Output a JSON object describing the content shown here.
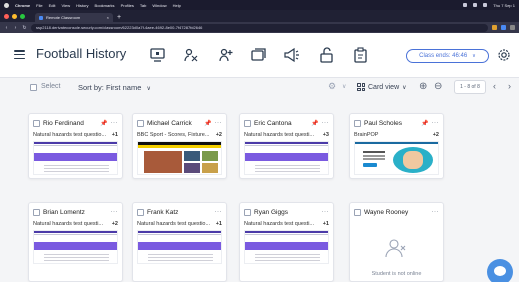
{
  "menubar": {
    "app": "Chrome",
    "items": [
      "File",
      "Edit",
      "View",
      "History",
      "Bookmarks",
      "Profiles",
      "Tab",
      "Window",
      "Help"
    ],
    "clock": "Thu 7 Sep 1"
  },
  "browser": {
    "tab_title": "Remote Classroom",
    "new_tab_icon": "+",
    "url": "ssp2118.derivateconsole.securly.com/classroom/62223d0a7f-4aee-4692-8e00-7f47287fd2646"
  },
  "header": {
    "title": "Football History",
    "class_ends": "Class ends: 46:46"
  },
  "toolbar": {
    "select_label": "Select",
    "sort_label": "Sort by:",
    "sort_value": "First name",
    "view_label": "Card view",
    "pagination": "1 - 8 of 8"
  },
  "cards": [
    {
      "name": "Rio Ferdinand",
      "pinned": true,
      "subtitle": "Natural hazards test questio...",
      "count": "+1",
      "thumb": "nh"
    },
    {
      "name": "Michael Carrick",
      "pinned": true,
      "subtitle": "BBC Sport - Scores, Fixture...",
      "count": "+2",
      "thumb": "bbc"
    },
    {
      "name": "Eric Cantona",
      "pinned": true,
      "subtitle": "Natural hazards test questi...",
      "count": "+3",
      "thumb": "nh"
    },
    {
      "name": "Paul Scholes",
      "pinned": true,
      "subtitle": "BrainPOP",
      "count": "+2",
      "thumb": "bp"
    },
    {
      "name": "Brian Lomentz",
      "pinned": false,
      "subtitle": "Natural hazards test questi...",
      "count": "+2",
      "thumb": "nh"
    },
    {
      "name": "Frank Katz",
      "pinned": false,
      "subtitle": "Natural hazards test questio...",
      "count": "+1",
      "thumb": "nh"
    },
    {
      "name": "Ryan Giggs",
      "pinned": false,
      "subtitle": "Natural hazards test questi...",
      "count": "+1",
      "thumb": "nh"
    },
    {
      "name": "Wayne Rooney",
      "pinned": false,
      "offline_text": "Student is not online"
    }
  ],
  "colors": {
    "accent": "#4a72d8",
    "header_text": "#2a3a4e",
    "chat": "#4a90e2"
  }
}
